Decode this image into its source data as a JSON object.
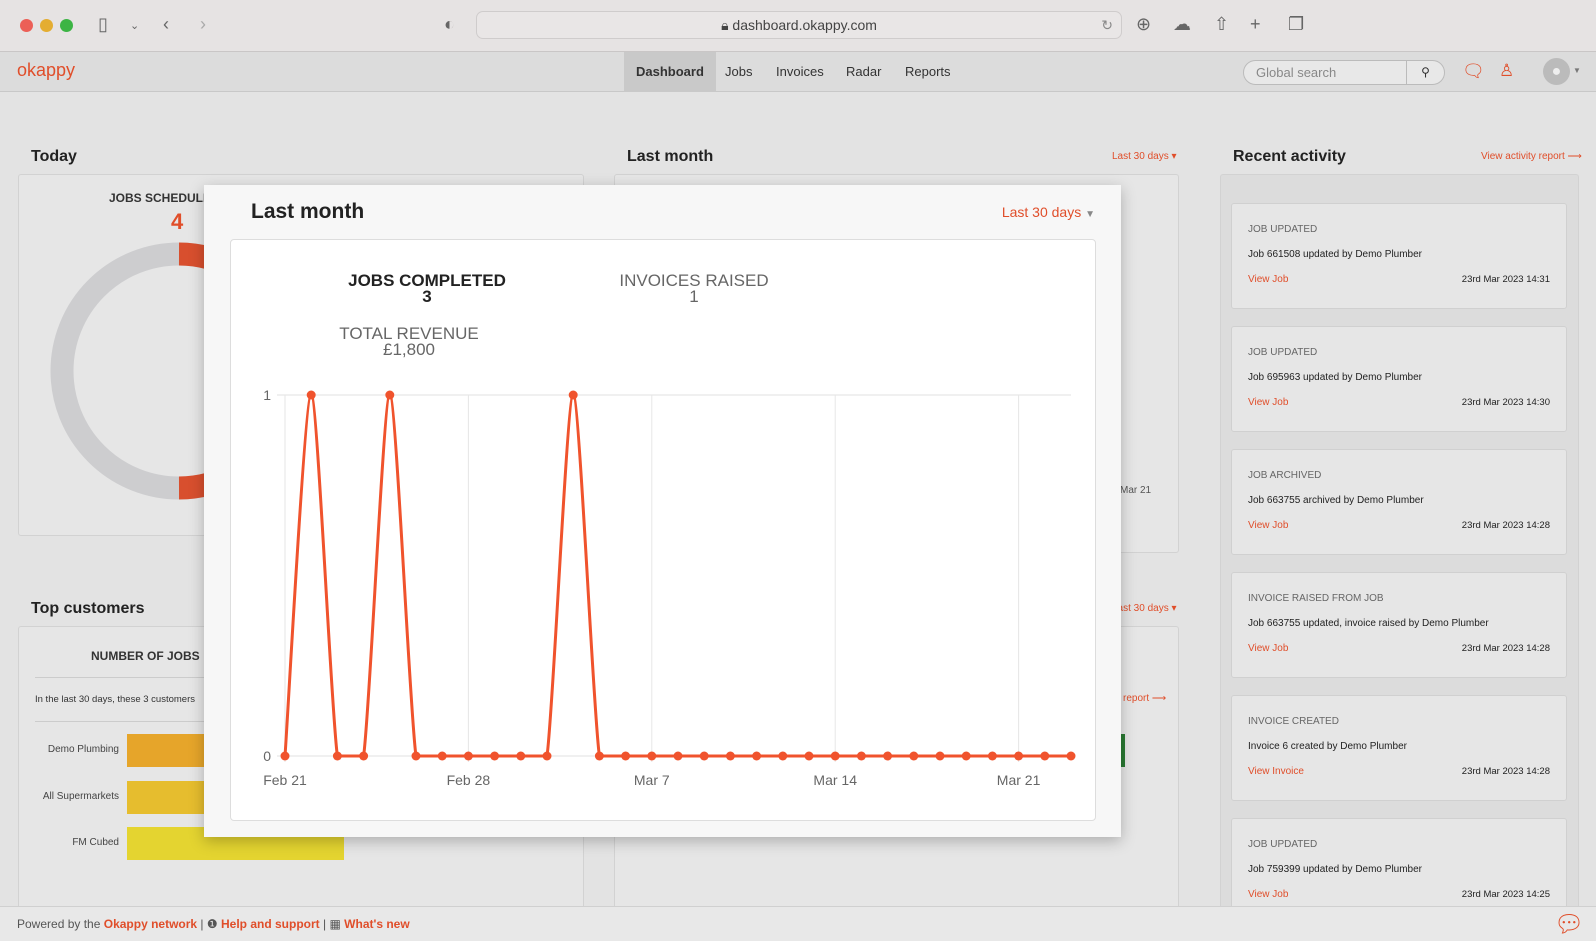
{
  "browser": {
    "url": "dashboard.okappy.com"
  },
  "nav": {
    "logo": "okappy",
    "items": [
      "Dashboard",
      "Jobs",
      "Invoices",
      "Radar",
      "Reports"
    ],
    "active": "Dashboard",
    "search_placeholder": "Global search"
  },
  "today": {
    "title": "Today",
    "jobs_label": "JOBS SCHEDULED",
    "jobs_value": "4"
  },
  "last_month_bg": {
    "title": "Last month",
    "range": "Last 30 days",
    "tick": "Mar 21"
  },
  "top_customers": {
    "title": "Top customers",
    "range": "Last 30 days",
    "jobs_label": "NUMBER OF JOBS",
    "desc": "In the last 30 days, these 3 customers",
    "report_link": "report",
    "customers": [
      {
        "name": "Demo Plumbing",
        "color": "#e6a52a"
      },
      {
        "name": "All Supermarkets",
        "color": "#e6bd2e"
      },
      {
        "name": "FM Cubed",
        "color": "#e4d430"
      }
    ]
  },
  "recent": {
    "title": "Recent activity",
    "link": "View activity report",
    "items": [
      {
        "type": "JOB UPDATED",
        "desc": "Job 661508 updated by Demo Plumber",
        "link": "View Job",
        "time": "23rd Mar 2023 14:31"
      },
      {
        "type": "JOB UPDATED",
        "desc": "Job 695963 updated by Demo Plumber",
        "link": "View Job",
        "time": "23rd Mar 2023 14:30"
      },
      {
        "type": "JOB ARCHIVED",
        "desc": "Job 663755 archived by Demo Plumber",
        "link": "View Job",
        "time": "23rd Mar 2023 14:28"
      },
      {
        "type": "INVOICE RAISED FROM JOB",
        "desc": "Job 663755 updated, invoice raised by Demo Plumber",
        "link": "View Job",
        "time": "23rd Mar 2023 14:28"
      },
      {
        "type": "INVOICE CREATED",
        "desc": "Invoice 6 created by Demo Plumber",
        "link": "View Invoice",
        "time": "23rd Mar 2023 14:28"
      },
      {
        "type": "JOB UPDATED",
        "desc": "Job 759399 updated by Demo Plumber",
        "link": "View Job",
        "time": "23rd Mar 2023 14:25"
      }
    ]
  },
  "modal": {
    "title": "Last month",
    "range": "Last 30 days",
    "jobs_completed_label": "JOBS COMPLETED",
    "jobs_completed": "3",
    "invoices_raised_label": "INVOICES RAISED",
    "invoices_raised": "1",
    "revenue_label": "TOTAL REVENUE",
    "revenue": "£1,800"
  },
  "footer": {
    "powered": "Powered by the",
    "network": "Okappy network",
    "help": "Help and support",
    "whats_new": "What's new"
  },
  "chart_data": {
    "type": "line",
    "color": "#f0532d",
    "x": [
      "Feb 21",
      "Feb 22",
      "Feb 23",
      "Feb 24",
      "Feb 25",
      "Feb 26",
      "Feb 27",
      "Feb 28",
      "Mar 1",
      "Mar 2",
      "Mar 3",
      "Mar 4",
      "Mar 5",
      "Mar 6",
      "Mar 7",
      "Mar 8",
      "Mar 9",
      "Mar 10",
      "Mar 11",
      "Mar 12",
      "Mar 13",
      "Mar 14",
      "Mar 15",
      "Mar 16",
      "Mar 17",
      "Mar 18",
      "Mar 19",
      "Mar 20",
      "Mar 21",
      "Mar 22",
      "Mar 23"
    ],
    "values": [
      0,
      1,
      0,
      0,
      1,
      0,
      0,
      0,
      0,
      0,
      0,
      1,
      0,
      0,
      0,
      0,
      0,
      0,
      0,
      0,
      0,
      0,
      0,
      0,
      0,
      0,
      0,
      0,
      0,
      0,
      0
    ],
    "x_ticks": [
      "Feb 21",
      "Feb 28",
      "Mar 7",
      "Mar 14",
      "Mar 21"
    ],
    "y_ticks": [
      "0",
      "1"
    ],
    "ylim": [
      0,
      1
    ],
    "grid": true
  }
}
